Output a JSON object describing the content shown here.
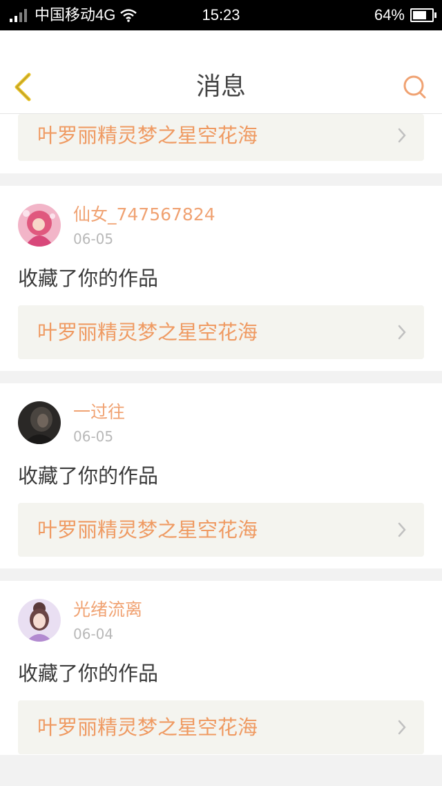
{
  "status_bar": {
    "carrier": "中国移动4G",
    "time": "15:23",
    "battery": "64%",
    "battery_level": 0.64
  },
  "navbar": {
    "title": "消息",
    "back_icon": "chevron-left-icon",
    "search_icon": "search-icon"
  },
  "colors": {
    "accent": "#ef9a62",
    "back_icon": "#e8c227"
  },
  "messages": [
    {
      "work_title": "叶罗丽精灵梦之星空花海"
    },
    {
      "username": "仙女_747567824",
      "date": "06-05",
      "action": "收藏了你的作品",
      "work_title": "叶罗丽精灵梦之星空花海"
    },
    {
      "username": "一过往",
      "date": "06-05",
      "action": "收藏了你的作品",
      "work_title": "叶罗丽精灵梦之星空花海"
    },
    {
      "username": "光绪流离",
      "date": "06-04",
      "action": "收藏了你的作品",
      "work_title": "叶罗丽精灵梦之星空花海"
    }
  ]
}
